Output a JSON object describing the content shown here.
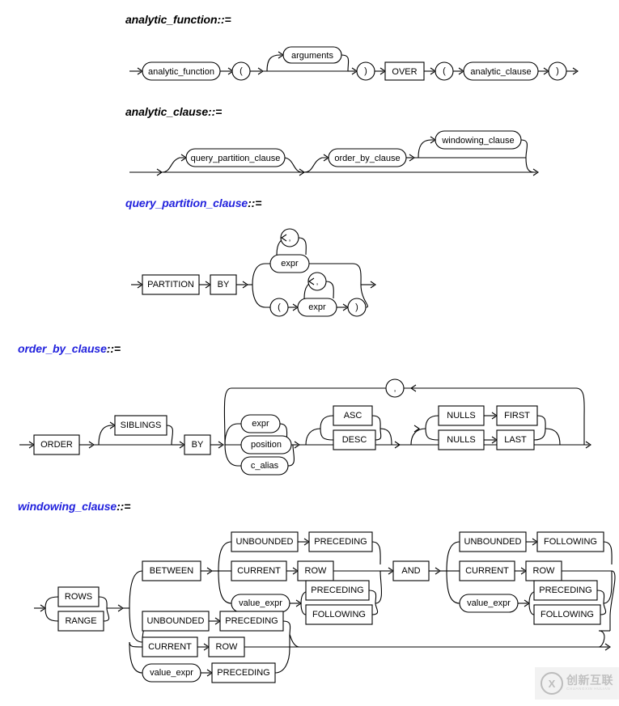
{
  "page": {
    "background": "#ffffff",
    "heading_blue": "#2222dd",
    "heading_black": "#000000",
    "line_color": "#000000"
  },
  "sections": [
    {
      "id": "analytic_function",
      "heading": "analytic_function",
      "heading_op": "::=",
      "heading_color": "#000000",
      "nodes": [
        {
          "label": "analytic_function",
          "kind": "nonterminal"
        },
        {
          "label": "(",
          "kind": "nonterminal"
        },
        {
          "label": "arguments",
          "kind": "nonterminal"
        },
        {
          "label": ")",
          "kind": "nonterminal"
        },
        {
          "label": "OVER",
          "kind": "keyword"
        },
        {
          "label": "(",
          "kind": "nonterminal"
        },
        {
          "label": "analytic_clause",
          "kind": "nonterminal"
        },
        {
          "label": ")",
          "kind": "nonterminal"
        }
      ]
    },
    {
      "id": "analytic_clause",
      "heading": "analytic_clause",
      "heading_op": "::=",
      "heading_color": "#000000",
      "nodes": [
        {
          "label": "query_partition_clause",
          "kind": "nonterminal"
        },
        {
          "label": "order_by_clause",
          "kind": "nonterminal"
        },
        {
          "label": "windowing_clause",
          "kind": "nonterminal"
        }
      ]
    },
    {
      "id": "query_partition_clause",
      "heading": "query_partition_clause",
      "heading_op": "::=",
      "heading_color": "#2222dd",
      "nodes": [
        {
          "label": "PARTITION",
          "kind": "keyword"
        },
        {
          "label": "BY",
          "kind": "keyword"
        },
        {
          "label": "expr",
          "kind": "nonterminal"
        },
        {
          "label": ",",
          "kind": "nonterminal"
        },
        {
          "label": "(",
          "kind": "nonterminal"
        },
        {
          "label": "expr",
          "kind": "nonterminal"
        },
        {
          "label": ")",
          "kind": "nonterminal"
        },
        {
          "label": ",",
          "kind": "nonterminal"
        }
      ]
    },
    {
      "id": "order_by_clause",
      "heading": "order_by_clause",
      "heading_op": "::=",
      "heading_color": "#2222dd",
      "nodes": [
        {
          "label": "ORDER",
          "kind": "keyword"
        },
        {
          "label": "SIBLINGS",
          "kind": "keyword"
        },
        {
          "label": "BY",
          "kind": "keyword"
        },
        {
          "label": "expr",
          "kind": "nonterminal"
        },
        {
          "label": "position",
          "kind": "nonterminal"
        },
        {
          "label": "c_alias",
          "kind": "nonterminal"
        },
        {
          "label": "ASC",
          "kind": "keyword"
        },
        {
          "label": "DESC",
          "kind": "keyword"
        },
        {
          "label": "NULLS",
          "kind": "keyword"
        },
        {
          "label": "FIRST",
          "kind": "keyword"
        },
        {
          "label": "NULLS",
          "kind": "keyword"
        },
        {
          "label": "LAST",
          "kind": "keyword"
        },
        {
          "label": ",",
          "kind": "nonterminal"
        }
      ]
    },
    {
      "id": "windowing_clause",
      "heading": "windowing_clause",
      "heading_op": "::=",
      "heading_color": "#2222dd",
      "nodes": [
        {
          "label": "ROWS",
          "kind": "keyword"
        },
        {
          "label": "RANGE",
          "kind": "keyword"
        },
        {
          "label": "BETWEEN",
          "kind": "keyword"
        },
        {
          "label": "UNBOUNDED",
          "kind": "keyword"
        },
        {
          "label": "PRECEDING",
          "kind": "keyword"
        },
        {
          "label": "CURRENT",
          "kind": "keyword"
        },
        {
          "label": "ROW",
          "kind": "keyword"
        },
        {
          "label": "value_expr",
          "kind": "nonterminal"
        },
        {
          "label": "PRECEDING",
          "kind": "keyword"
        },
        {
          "label": "FOLLOWING",
          "kind": "keyword"
        },
        {
          "label": "AND",
          "kind": "keyword"
        },
        {
          "label": "UNBOUNDED",
          "kind": "keyword"
        },
        {
          "label": "FOLLOWING",
          "kind": "keyword"
        },
        {
          "label": "CURRENT",
          "kind": "keyword"
        },
        {
          "label": "ROW",
          "kind": "keyword"
        },
        {
          "label": "value_expr",
          "kind": "nonterminal"
        },
        {
          "label": "PRECEDING",
          "kind": "keyword"
        },
        {
          "label": "FOLLOWING",
          "kind": "keyword"
        },
        {
          "label": "UNBOUNDED",
          "kind": "keyword"
        },
        {
          "label": "PRECEDING",
          "kind": "keyword"
        },
        {
          "label": "CURRENT",
          "kind": "keyword"
        },
        {
          "label": "ROW",
          "kind": "keyword"
        },
        {
          "label": "value_expr",
          "kind": "nonterminal"
        },
        {
          "label": "PRECEDING",
          "kind": "keyword"
        }
      ]
    }
  ],
  "labels": {
    "analytic_function": "analytic_function",
    "arguments": "arguments",
    "analytic_clause": "analytic_clause",
    "over": "OVER",
    "lparen": "(",
    "rparen": ")",
    "query_partition_clause": "query_partition_clause",
    "order_by_clause": "order_by_clause",
    "windowing_clause": "windowing_clause",
    "partition": "PARTITION",
    "by": "BY",
    "expr": "expr",
    "comma": ",",
    "order": "ORDER",
    "siblings": "SIBLINGS",
    "position": "position",
    "c_alias": "c_alias",
    "asc": "ASC",
    "desc": "DESC",
    "nulls": "NULLS",
    "first": "FIRST",
    "last": "LAST",
    "rows": "ROWS",
    "range": "RANGE",
    "between": "BETWEEN",
    "unbounded": "UNBOUNDED",
    "preceding": "PRECEDING",
    "current": "CURRENT",
    "row": "ROW",
    "value_expr": "value_expr",
    "following": "FOLLOWING",
    "and": "AND"
  },
  "watermark": {
    "logo": "X",
    "cn": "创新互联",
    "en": "CHUANGXIN HULIAN"
  }
}
